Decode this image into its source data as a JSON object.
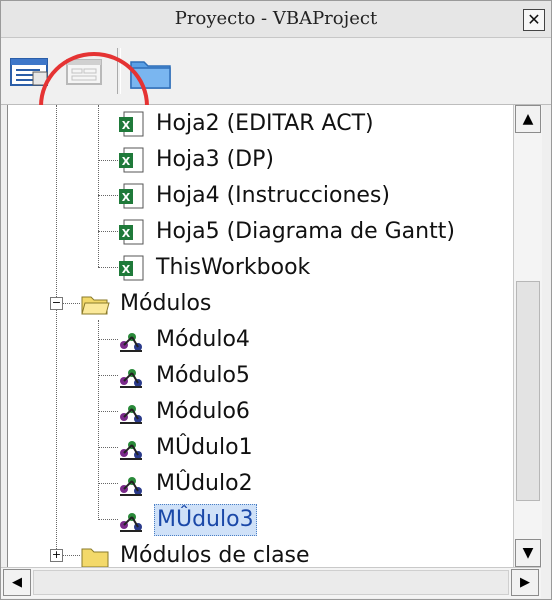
{
  "window": {
    "title": "Proyecto - VBAProject",
    "close_symbol": "✕"
  },
  "toolbar": {
    "buttons": [
      {
        "name": "view-code-icon"
      },
      {
        "name": "view-object-icon",
        "disabled": true
      },
      {
        "name": "toggle-folders-icon"
      }
    ]
  },
  "tree": {
    "sheets": [
      {
        "label": "Hoja2 (EDITAR ACT)"
      },
      {
        "label": "Hoja3 (DP)"
      },
      {
        "label": "Hoja4 (Instrucciones)"
      },
      {
        "label": "Hoja5 (Diagrama de Gantt)"
      },
      {
        "label": "ThisWorkbook"
      }
    ],
    "modules_folder": {
      "label": "Módulos",
      "expander": "−"
    },
    "modules": [
      {
        "label": "Módulo4"
      },
      {
        "label": "Módulo5"
      },
      {
        "label": "Módulo6"
      },
      {
        "label": "MÛdulo1"
      },
      {
        "label": "MÛdulo2"
      },
      {
        "label": "MÛdulo3",
        "selected": true
      }
    ],
    "class_modules_folder": {
      "label": "Módulos de clase",
      "expander": "+"
    }
  },
  "scrollbar": {
    "up": "▲",
    "down": "▼",
    "left": "◀",
    "right": "▶"
  },
  "colors": {
    "annotation_circle": "#e53333",
    "selection_bg": "#cfe1f8",
    "excel_green": "#1f7a3a",
    "folder_yellow": "#f3d96a"
  }
}
